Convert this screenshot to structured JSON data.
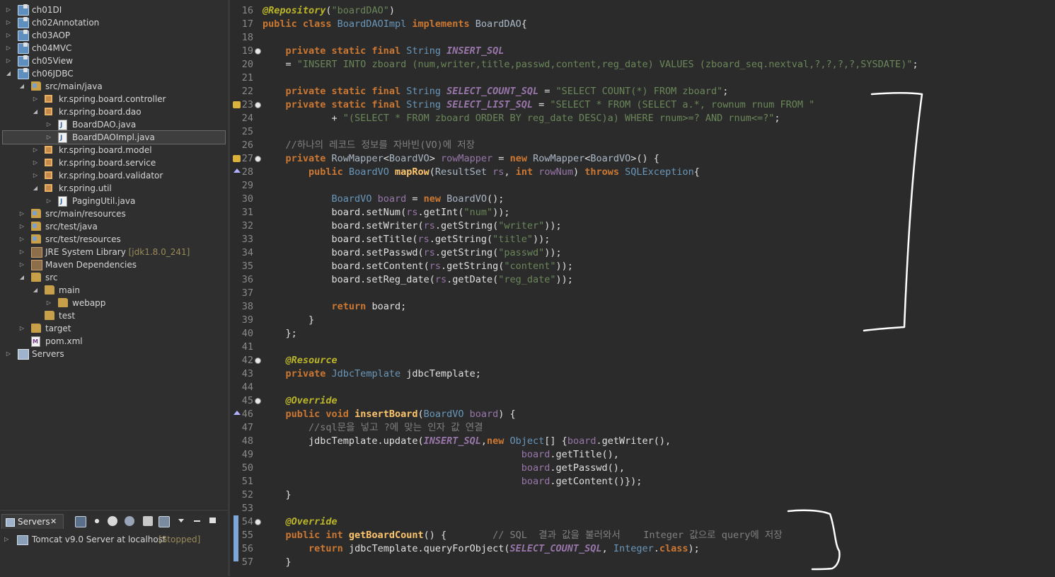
{
  "explorer": {
    "items": [
      {
        "label": "ch01DI",
        "arrow": "▷",
        "icon": "project",
        "decor": ""
      },
      {
        "label": "ch02Annotation",
        "arrow": "▷",
        "icon": "project",
        "decor": ""
      },
      {
        "label": "ch03AOP",
        "arrow": "▷",
        "icon": "project",
        "decor": ""
      },
      {
        "label": "ch04MVC",
        "arrow": "▷",
        "icon": "project",
        "decor": ""
      },
      {
        "label": "ch05View",
        "arrow": "▷",
        "icon": "project",
        "decor": ""
      },
      {
        "label": "ch06JDBC",
        "arrow": "◢",
        "icon": "project",
        "decor": ""
      },
      {
        "label": "src/main/java",
        "arrow": "◢",
        "icon": "srcfolder",
        "decor": ""
      },
      {
        "label": "kr.spring.board.controller",
        "arrow": "▷",
        "icon": "package",
        "decor": ""
      },
      {
        "label": "kr.spring.board.dao",
        "arrow": "◢",
        "icon": "package",
        "decor": ""
      },
      {
        "label": "BoardDAO.java",
        "arrow": "▷",
        "icon": "java",
        "decor": ""
      },
      {
        "label": "BoardDAOImpl.java",
        "arrow": "▷",
        "icon": "java",
        "decor": ""
      },
      {
        "label": "kr.spring.board.model",
        "arrow": "▷",
        "icon": "package",
        "decor": ""
      },
      {
        "label": "kr.spring.board.service",
        "arrow": "▷",
        "icon": "package",
        "decor": ""
      },
      {
        "label": "kr.spring.board.validator",
        "arrow": "▷",
        "icon": "package",
        "decor": ""
      },
      {
        "label": "kr.spring.util",
        "arrow": "◢",
        "icon": "package",
        "decor": ""
      },
      {
        "label": "PagingUtil.java",
        "arrow": "▷",
        "icon": "java",
        "decor": ""
      },
      {
        "label": "src/main/resources",
        "arrow": "▷",
        "icon": "srcfolder",
        "decor": ""
      },
      {
        "label": "src/test/java",
        "arrow": "▷",
        "icon": "srcfolder",
        "decor": ""
      },
      {
        "label": "src/test/resources",
        "arrow": "▷",
        "icon": "srcfolder",
        "decor": ""
      },
      {
        "label": "JRE System Library",
        "arrow": "▷",
        "icon": "lib",
        "decor": "[jdk1.8.0_241]"
      },
      {
        "label": "Maven Dependencies",
        "arrow": "▷",
        "icon": "lib",
        "decor": ""
      },
      {
        "label": "src",
        "arrow": "◢",
        "icon": "folder",
        "decor": ""
      },
      {
        "label": "main",
        "arrow": "◢",
        "icon": "folder",
        "decor": ""
      },
      {
        "label": "webapp",
        "arrow": "▷",
        "icon": "folder",
        "decor": ""
      },
      {
        "label": "test",
        "arrow": "",
        "icon": "folder",
        "decor": ""
      },
      {
        "label": "target",
        "arrow": "▷",
        "icon": "folder",
        "decor": ""
      },
      {
        "label": "pom.xml",
        "arrow": "",
        "icon": "xml",
        "decor": ""
      },
      {
        "label": "Servers",
        "arrow": "▷",
        "icon": "servers",
        "decor": ""
      }
    ]
  },
  "servers_panel": {
    "tab_label": "Servers",
    "close_glyph": "✕",
    "server_name": "Tomcat v9.0 Server at localhost",
    "server_status": "[Stopped]"
  },
  "editor": {
    "lines": [
      {
        "n": "16",
        "tokens": [
          [
            "ann",
            "@Repository"
          ],
          [
            "plain",
            "("
          ],
          [
            "str",
            "\"boardDAO\""
          ],
          [
            "plain",
            ")"
          ]
        ]
      },
      {
        "n": "17",
        "tokens": [
          [
            "kw",
            "public class "
          ],
          [
            "type",
            "BoardDAOImpl"
          ],
          [
            "kw",
            " implements "
          ],
          [
            "ty2",
            "BoardDAO"
          ],
          [
            "plain",
            "{"
          ]
        ]
      },
      {
        "n": "18",
        "tokens": []
      },
      {
        "n": "19",
        "tokens": [
          [
            "plain",
            "    "
          ],
          [
            "kw",
            "private static final "
          ],
          [
            "type",
            "String "
          ],
          [
            "const",
            "INSERT_SQL"
          ]
        ]
      },
      {
        "n": "20",
        "tokens": [
          [
            "plain",
            "    = "
          ],
          [
            "str",
            "\"INSERT INTO zboard (num,writer,title,passwd,content,reg_date) VALUES (zboard_seq.nextval,?,?,?,?,SYSDATE)\""
          ],
          [
            "plain",
            ";"
          ]
        ]
      },
      {
        "n": "21",
        "tokens": []
      },
      {
        "n": "22",
        "tokens": [
          [
            "plain",
            "    "
          ],
          [
            "kw",
            "private static final "
          ],
          [
            "type",
            "String "
          ],
          [
            "const",
            "SELECT_COUNT_SQL"
          ],
          [
            "plain",
            " = "
          ],
          [
            "str",
            "\"SELECT COUNT(*) FROM zboard\""
          ],
          [
            "plain",
            ";"
          ]
        ]
      },
      {
        "n": "23",
        "tokens": [
          [
            "plain",
            "    "
          ],
          [
            "kw",
            "private static final "
          ],
          [
            "type",
            "String "
          ],
          [
            "const",
            "SELECT_LIST_SQL"
          ],
          [
            "plain",
            " = "
          ],
          [
            "str",
            "\"SELECT * FROM (SELECT a.*, rownum rnum FROM \""
          ]
        ]
      },
      {
        "n": "24",
        "tokens": [
          [
            "plain",
            "            + "
          ],
          [
            "str",
            "\"(SELECT * FROM zboard ORDER BY reg_date DESC)a) WHERE rnum>=? AND rnum<=?\""
          ],
          [
            "plain",
            ";"
          ]
        ]
      },
      {
        "n": "25",
        "tokens": []
      },
      {
        "n": "26",
        "tokens": [
          [
            "plain",
            "    "
          ],
          [
            "cmt",
            "//하나의 레코드 정보를 자바빈(VO)에 저장"
          ]
        ]
      },
      {
        "n": "27",
        "tokens": [
          [
            "plain",
            "    "
          ],
          [
            "kw",
            "private "
          ],
          [
            "ty2",
            "RowMapper"
          ],
          [
            "plain",
            "<"
          ],
          [
            "ty2",
            "BoardVO"
          ],
          [
            "plain",
            "> "
          ],
          [
            "field",
            "rowMapper"
          ],
          [
            "plain",
            " = "
          ],
          [
            "kw",
            "new "
          ],
          [
            "ty2",
            "RowMapper"
          ],
          [
            "plain",
            "<"
          ],
          [
            "ty2",
            "BoardVO"
          ],
          [
            "plain",
            ">() {"
          ]
        ]
      },
      {
        "n": "28",
        "tokens": [
          [
            "plain",
            "        "
          ],
          [
            "kw",
            "public "
          ],
          [
            "type",
            "BoardVO "
          ],
          [
            "meth",
            "mapRow"
          ],
          [
            "plain",
            "("
          ],
          [
            "ty2",
            "ResultSet "
          ],
          [
            "var",
            "rs"
          ],
          [
            "plain",
            ", "
          ],
          [
            "kw",
            "int "
          ],
          [
            "var",
            "rowNum"
          ],
          [
            "plain",
            ") "
          ],
          [
            "kw",
            "throws "
          ],
          [
            "type",
            "SQLException"
          ],
          [
            "plain",
            "{"
          ]
        ]
      },
      {
        "n": "29",
        "tokens": []
      },
      {
        "n": "30",
        "tokens": [
          [
            "plain",
            "            "
          ],
          [
            "type",
            "BoardVO "
          ],
          [
            "field",
            "board"
          ],
          [
            "plain",
            " = "
          ],
          [
            "kw",
            "new "
          ],
          [
            "ty2",
            "BoardVO"
          ],
          [
            "plain",
            "();"
          ]
        ]
      },
      {
        "n": "31",
        "tokens": [
          [
            "plain",
            "            board.setNum("
          ],
          [
            "var",
            "rs"
          ],
          [
            "plain",
            ".getInt("
          ],
          [
            "str",
            "\"num\""
          ],
          [
            "plain",
            "));"
          ]
        ]
      },
      {
        "n": "32",
        "tokens": [
          [
            "plain",
            "            board.setWriter("
          ],
          [
            "var",
            "rs"
          ],
          [
            "plain",
            ".getString("
          ],
          [
            "str",
            "\"writer\""
          ],
          [
            "plain",
            "));"
          ]
        ]
      },
      {
        "n": "33",
        "tokens": [
          [
            "plain",
            "            board.setTitle("
          ],
          [
            "var",
            "rs"
          ],
          [
            "plain",
            ".getString("
          ],
          [
            "str",
            "\"title\""
          ],
          [
            "plain",
            "));"
          ]
        ]
      },
      {
        "n": "34",
        "tokens": [
          [
            "plain",
            "            board.setPasswd("
          ],
          [
            "var",
            "rs"
          ],
          [
            "plain",
            ".getString("
          ],
          [
            "str",
            "\"passwd\""
          ],
          [
            "plain",
            "));"
          ]
        ]
      },
      {
        "n": "35",
        "tokens": [
          [
            "plain",
            "            board.setContent("
          ],
          [
            "var",
            "rs"
          ],
          [
            "plain",
            ".getString("
          ],
          [
            "str",
            "\"content\""
          ],
          [
            "plain",
            "));"
          ]
        ]
      },
      {
        "n": "36",
        "tokens": [
          [
            "plain",
            "            board.setReg_date("
          ],
          [
            "var",
            "rs"
          ],
          [
            "plain",
            ".getDate("
          ],
          [
            "str",
            "\"reg_date\""
          ],
          [
            "plain",
            "));"
          ]
        ]
      },
      {
        "n": "37",
        "tokens": []
      },
      {
        "n": "38",
        "tokens": [
          [
            "plain",
            "            "
          ],
          [
            "kw",
            "return "
          ],
          [
            "plain",
            "board;"
          ]
        ]
      },
      {
        "n": "39",
        "tokens": [
          [
            "plain",
            "        }"
          ]
        ]
      },
      {
        "n": "40",
        "tokens": [
          [
            "plain",
            "    };"
          ]
        ]
      },
      {
        "n": "41",
        "tokens": []
      },
      {
        "n": "42",
        "tokens": [
          [
            "plain",
            "    "
          ],
          [
            "ann",
            "@Resource"
          ]
        ]
      },
      {
        "n": "43",
        "tokens": [
          [
            "plain",
            "    "
          ],
          [
            "kw",
            "private "
          ],
          [
            "type",
            "JdbcTemplate "
          ],
          [
            "plain",
            "jdbcTemplate;"
          ]
        ]
      },
      {
        "n": "44",
        "tokens": []
      },
      {
        "n": "45",
        "tokens": [
          [
            "plain",
            "    "
          ],
          [
            "ann",
            "@Override"
          ]
        ]
      },
      {
        "n": "46",
        "tokens": [
          [
            "plain",
            "    "
          ],
          [
            "kw",
            "public void "
          ],
          [
            "meth",
            "insertBoard"
          ],
          [
            "plain",
            "("
          ],
          [
            "type",
            "BoardVO "
          ],
          [
            "var",
            "board"
          ],
          [
            "plain",
            ") {"
          ]
        ]
      },
      {
        "n": "47",
        "tokens": [
          [
            "plain",
            "        "
          ],
          [
            "cmt",
            "//sql문을 넣고 ?에 맞는 인자 값 연결"
          ]
        ]
      },
      {
        "n": "48",
        "tokens": [
          [
            "plain",
            "        jdbcTemplate.update("
          ],
          [
            "const",
            "INSERT_SQL"
          ],
          [
            "plain",
            ","
          ],
          [
            "kw",
            "new "
          ],
          [
            "type",
            "Object"
          ],
          [
            "plain",
            "[] {"
          ],
          [
            "var",
            "board"
          ],
          [
            "plain",
            ".getWriter(),"
          ]
        ]
      },
      {
        "n": "49",
        "tokens": [
          [
            "plain",
            "                                             "
          ],
          [
            "var",
            "board"
          ],
          [
            "plain",
            ".getTitle(),"
          ]
        ]
      },
      {
        "n": "50",
        "tokens": [
          [
            "plain",
            "                                             "
          ],
          [
            "var",
            "board"
          ],
          [
            "plain",
            ".getPasswd(),"
          ]
        ]
      },
      {
        "n": "51",
        "tokens": [
          [
            "plain",
            "                                             "
          ],
          [
            "var",
            "board"
          ],
          [
            "plain",
            ".getContent()});"
          ]
        ]
      },
      {
        "n": "52",
        "tokens": [
          [
            "plain",
            "    }"
          ]
        ]
      },
      {
        "n": "53",
        "tokens": []
      },
      {
        "n": "54",
        "tokens": [
          [
            "plain",
            "    "
          ],
          [
            "ann",
            "@Override"
          ]
        ]
      },
      {
        "n": "55",
        "tokens": [
          [
            "plain",
            "    "
          ],
          [
            "kw",
            "public int "
          ],
          [
            "meth",
            "getBoardCount"
          ],
          [
            "plain",
            "() {        "
          ],
          [
            "cmt",
            "// SQL  결과 값을 불러와서    Integer 값으로 query에 저장"
          ]
        ]
      },
      {
        "n": "56",
        "tokens": [
          [
            "plain",
            "        "
          ],
          [
            "kw",
            "return "
          ],
          [
            "plain",
            "jdbcTemplate.queryForObject("
          ],
          [
            "const",
            "SELECT_COUNT_SQL"
          ],
          [
            "plain",
            ", "
          ],
          [
            "type",
            "Integer"
          ],
          [
            "plain",
            "."
          ],
          [
            "kw",
            "class"
          ],
          [
            "plain",
            ");"
          ]
        ]
      },
      {
        "n": "57",
        "tokens": [
          [
            "plain",
            "    }"
          ]
        ]
      }
    ]
  },
  "colors": {
    "editor_bg": "#2b2b2b",
    "explorer_bg": "#2f2f2f",
    "keyword": "#cc7832",
    "string": "#6a8759",
    "annotation": "#bbb529",
    "constant": "#9876aa",
    "type": "#6897bb",
    "comment": "#808080",
    "method": "#ffc66d"
  }
}
